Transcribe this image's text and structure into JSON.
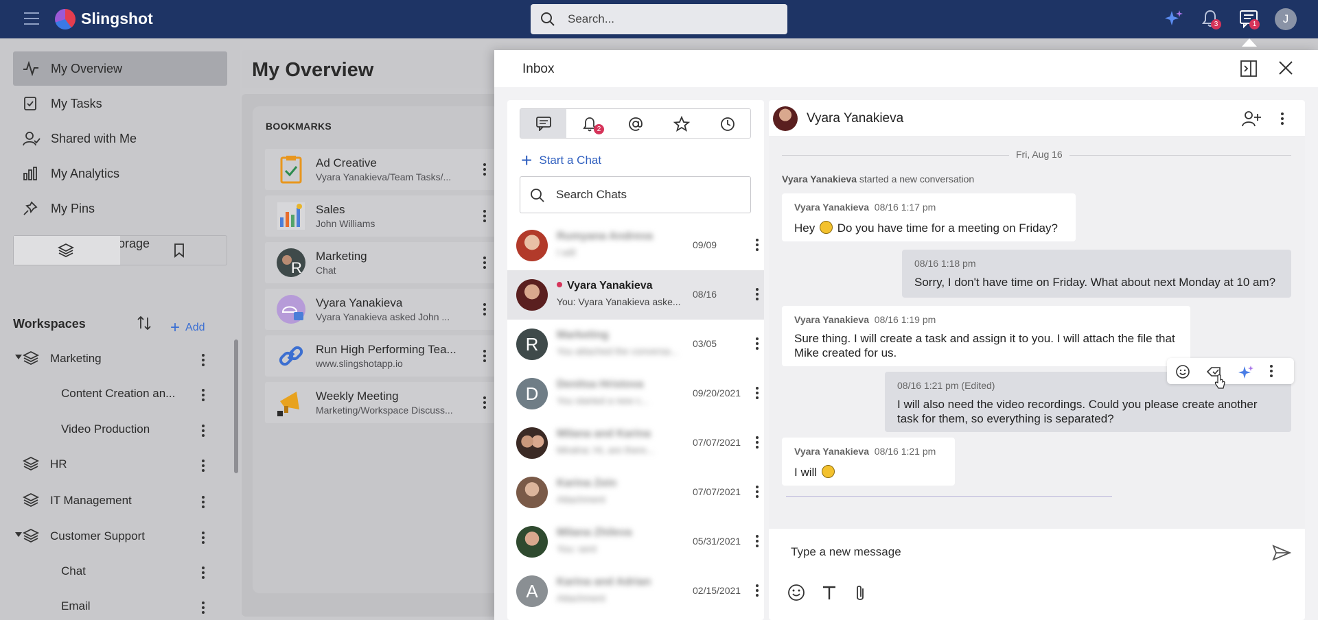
{
  "topbar": {
    "brand": "Slingshot",
    "search_placeholder": "Search...",
    "notification_count": "3",
    "inbox_count": "1",
    "avatar_initial": "J",
    "colors": {
      "bar": "#1e3465",
      "badge": "#d6345a"
    }
  },
  "sidebar": {
    "nav": [
      {
        "label": "My Overview",
        "icon": "activity-icon"
      },
      {
        "label": "My Tasks",
        "icon": "task-check-icon"
      },
      {
        "label": "Shared with Me",
        "icon": "user-shared-icon"
      },
      {
        "label": "My Analytics",
        "icon": "bar-chart-icon"
      },
      {
        "label": "My Pins",
        "icon": "pin-icon"
      },
      {
        "label": "My Cloud Storage",
        "icon": "cloud-icon"
      }
    ],
    "workspaces_title": "Workspaces",
    "add_label": "Add",
    "tree": [
      {
        "label": "Marketing"
      },
      {
        "label": "Content Creation an..."
      },
      {
        "label": "Video Production"
      },
      {
        "label": "HR"
      },
      {
        "label": "IT Management"
      },
      {
        "label": "Customer Support"
      },
      {
        "label": "Chat"
      },
      {
        "label": "Email"
      }
    ]
  },
  "main": {
    "title": "My Overview",
    "bookmarks_title": "BOOKMARKS",
    "bookmarks": [
      {
        "name": "Ad Creative",
        "sub": "Vyara Yanakieva/Team Tasks/..."
      },
      {
        "name": "Sales",
        "sub": "John Williams"
      },
      {
        "name": "Marketing",
        "sub": "Chat"
      },
      {
        "name": "Vyara Yanakieva",
        "sub": "Vyara Yanakieva asked John ..."
      },
      {
        "name": "Run High Performing Tea...",
        "sub": "www.slingshotapp.io"
      },
      {
        "name": "Weekly Meeting",
        "sub": "Marketing/Workspace Discuss..."
      }
    ]
  },
  "inbox": {
    "title": "Inbox",
    "mentions_badge": "2",
    "start_chat": "Start a Chat",
    "search_placeholder": "Search Chats",
    "chats": [
      {
        "name": "Rumyana Andreva",
        "preview": "I will",
        "date": "09/09",
        "initial": ""
      },
      {
        "name": "Vyara Yanakieva",
        "preview": "You: Vyara Yanakieva aske...",
        "date": "08/16",
        "initial": ""
      },
      {
        "name": "Marketing",
        "preview": "You attached the conversa...",
        "date": "03/05",
        "initial": "R"
      },
      {
        "name": "Denitsa Hristova",
        "preview": "You started a new c...",
        "date": "09/20/2021",
        "initial": "D"
      },
      {
        "name": "Milana and Karina",
        "preview": "Miralna: Hi, are there...",
        "date": "07/07/2021",
        "initial": ""
      },
      {
        "name": "Karina Zein",
        "preview": "Attachment",
        "date": "07/07/2021",
        "initial": ""
      },
      {
        "name": "Milana Zhileva",
        "preview": "You: sent",
        "date": "05/31/2021",
        "initial": ""
      },
      {
        "name": "Karina and Adrian",
        "preview": "Attachment",
        "date": "02/15/2021",
        "initial": "A"
      }
    ]
  },
  "conversation": {
    "name": "Vyara Yanakieva",
    "date_separator": "Fri, Aug 16",
    "system_author": "Vyara Yanakieva",
    "system_text": "started a new conversation",
    "messages": [
      {
        "author": "Vyara Yanakieva",
        "time": "08/16 1:17 pm",
        "edited": "",
        "text_before": "Hey ",
        "text_after": " Do you have time for a meeting on Friday?"
      },
      {
        "author": "",
        "time": "08/16 1:18 pm",
        "edited": "",
        "text": "Sorry, I don't have time on Friday. What about next Monday at 10 am?"
      },
      {
        "author": "Vyara Yanakieva",
        "time": "08/16 1:19 pm",
        "edited": "",
        "text": "Sure thing. I will create a task and assign it to you. I will attach the file that Mike created for us."
      },
      {
        "author": "",
        "time": "08/16 1:21 pm",
        "edited": "(Edited)",
        "text": "I will also need the video recordings. Could you please create another task for them, so everything is separated?"
      },
      {
        "author": "Vyara Yanakieva",
        "time": "08/16 1:21 pm",
        "edited": "",
        "text": "I will "
      }
    ],
    "compose_placeholder": "Type a new message"
  }
}
